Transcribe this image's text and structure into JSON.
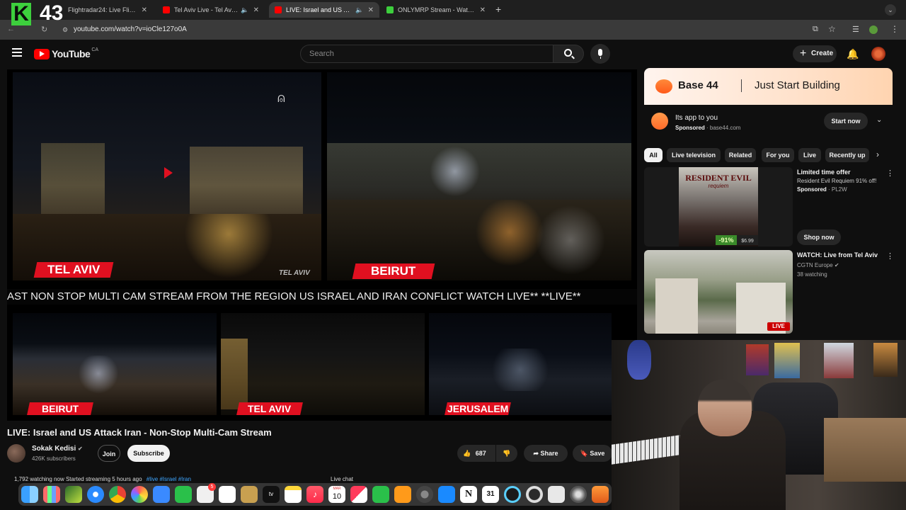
{
  "overlay": {
    "logo_letter": "K",
    "number": "43"
  },
  "browser": {
    "tabs": [
      {
        "title": "Flightradar24: Live Flight Tra",
        "active": false
      },
      {
        "title": "Tel Aviv Live - Tel Aviv Sk",
        "active": false
      },
      {
        "title": "LIVE: Israel and US Attack",
        "active": true
      },
      {
        "title": "ONLYMRP Stream - Watch Li",
        "active": false
      }
    ],
    "url": "youtube.com/watch?v=ioCle127o0A"
  },
  "youtube": {
    "logo_text": "YouTube",
    "region": "CA",
    "search_placeholder": "Search",
    "create_label": "Create"
  },
  "video": {
    "labels": [
      "TEL AVIV",
      "BEIRUT",
      "BEIRUT",
      "TEL AVIV",
      "JERUSALEM"
    ],
    "watermark": "TEL AVIV",
    "ticker": "AST NON STOP MULTI CAM STREAM FROM THE REGION US ISRAEL AND IRAN CONFLICT WATCH LIVE**     **LIVE**",
    "title": "LIVE: Israel and US Attack Iran - Non-Stop Multi-Cam Stream",
    "channel": "Sokak Kedisi",
    "subscribers": "426K subscribers",
    "join_label": "Join",
    "subscribe_label": "Subscribe",
    "likes": "687",
    "share_label": "Share",
    "save_label": "Save",
    "stats": "1,792 watching now  Started streaming 5 hours ago",
    "hashtags": "#live #Israel #Iran",
    "live_chat_label": "Live chat"
  },
  "ad": {
    "brand": "Base 44",
    "tagline": "Just Start Building",
    "headline": "Its app to you",
    "sponsored": "Sponsored",
    "domain": "base44.com",
    "cta": "Start now"
  },
  "chips": [
    "All",
    "Live television",
    "Related",
    "For you",
    "Live",
    "Recently up"
  ],
  "recommendations": [
    {
      "title": "Limited time offer",
      "subtitle": "Resident Evil Requiem 91% off!",
      "sponsored": "Sponsored",
      "advertiser": "PL2W",
      "thumb_title": "RESIDENT EVIL",
      "thumb_sub": "requiem",
      "discount": "-91%",
      "price": "$6.99",
      "cta": "Shop now"
    },
    {
      "title": "WATCH: Live from Tel Aviv",
      "channel": "CGTN Europe",
      "meta": "38 watching",
      "badge": "LIVE"
    }
  ],
  "dock": {
    "calendar_month": "MAR",
    "calendar_day": "10",
    "notion_day": "31",
    "badge": "5"
  },
  "colors": {
    "accent_red": "#e01020",
    "yt_red": "#ff0000",
    "bg": "#0f0f0f",
    "chip_bg": "#272727"
  }
}
